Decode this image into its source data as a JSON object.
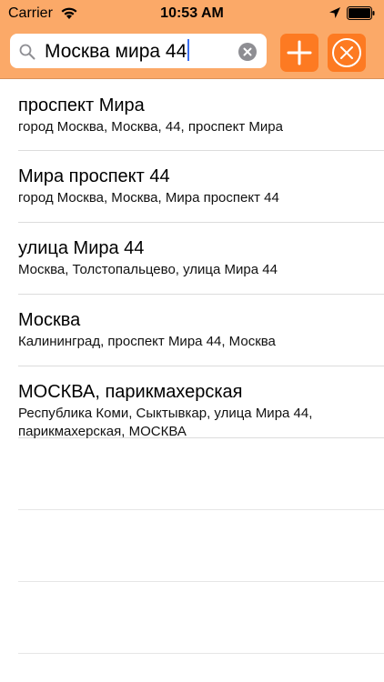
{
  "status_bar": {
    "carrier": "Carrier",
    "time": "10:53 AM"
  },
  "search": {
    "query": "Москва мира 44"
  },
  "colors": {
    "header_background": "#fba968",
    "button_accent": "#fd7a22"
  },
  "results": [
    {
      "title": "проспект Мира",
      "subtitle": "город Москва, Москва, 44, проспект Мира"
    },
    {
      "title": "Мира проспект 44",
      "subtitle": "город Москва, Москва, Мира проспект 44"
    },
    {
      "title": "улица Мира 44",
      "subtitle": "Москва, Толстопальцево, улица Мира 44"
    },
    {
      "title": "Москва",
      "subtitle": "Калининград, проспект Мира 44, Москва"
    },
    {
      "title": "МОСКВА, парикмахерская",
      "subtitle": "Республика Коми, Сыктывкар, улица Мира 44, парикмахерская, МОСКВА"
    }
  ],
  "icons": {
    "wifi": "wifi-icon",
    "location": "location-arrow-icon",
    "battery": "battery-icon",
    "search": "search-icon",
    "clear": "clear-icon",
    "add": "plus-icon",
    "close": "close-circle-icon"
  }
}
